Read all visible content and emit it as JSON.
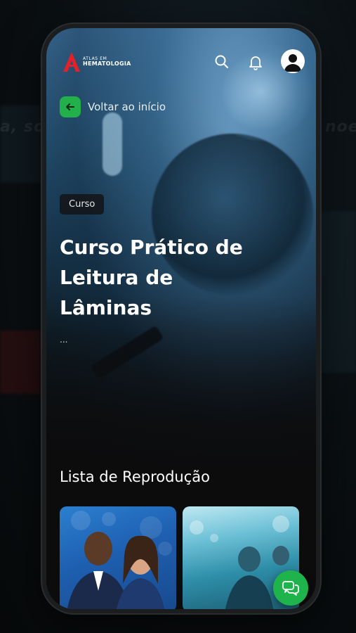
{
  "background": {
    "blurred_texts": [
      "a, sou",
      "noe"
    ]
  },
  "brand": {
    "logo_line1": "ATLAS EM",
    "logo_line2": "HEMATOLOGIA",
    "accent": "#e4202a"
  },
  "header": {
    "search_icon": "search-icon",
    "notification_icon": "bell-icon",
    "profile_icon": "user-avatar-icon"
  },
  "back": {
    "label": "Voltar ao início",
    "icon": "arrow-left-icon",
    "color": "#21b04a"
  },
  "course": {
    "badge": "Curso",
    "title": "Curso Prático de Leitura de Lâminas",
    "description": "..."
  },
  "playlist": {
    "title": "Lista de Reprodução"
  },
  "chat": {
    "icon": "chat-bubbles-icon",
    "color": "#1fb34b"
  }
}
